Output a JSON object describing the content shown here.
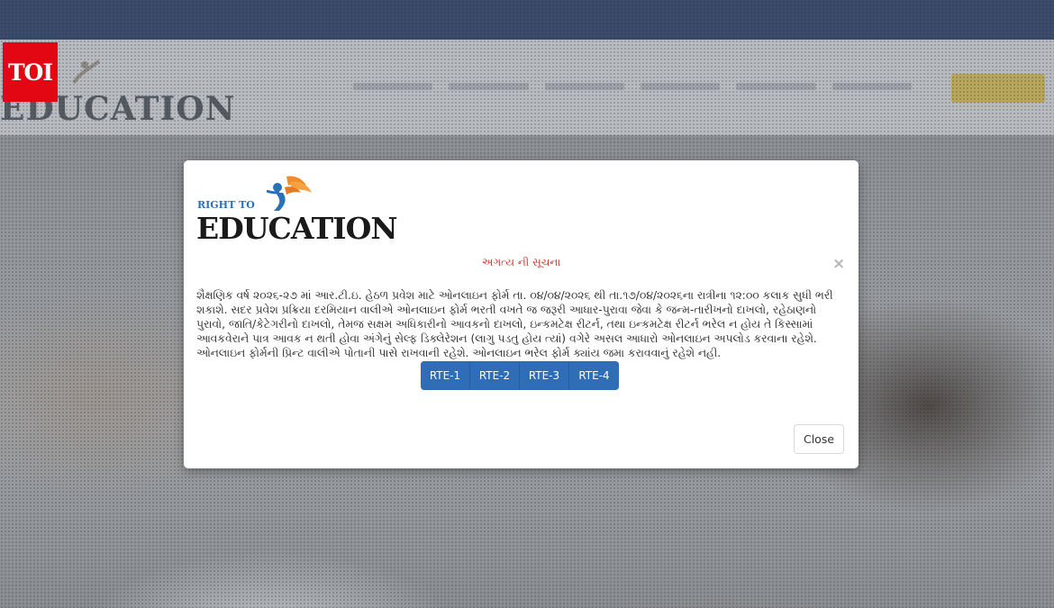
{
  "watermark": {
    "label": "TOI",
    "color": "#e30613"
  },
  "background": {
    "logo_text": "EDUCATION"
  },
  "modal": {
    "logo": {
      "line1": "RIGHT TO",
      "line2": "EDUCATION"
    },
    "title": "અગત્ય ની સૂચના",
    "close_x": "×",
    "body": "શૈક્ષણિક વર્ષ ૨૦૨૬-૨૭ માં આર.ટી.ઇ. હેઠળ પ્રવેશ માટે ઓનલાઇન ફોર્મ તા. ૦૪/૦૪/૨૦૨૬ થી તા.૧૭/૦૪/૨૦૨૬ના રાત્રીના ૧૨:૦૦ કલાક સુધી ભરી શકાશે. સદર પ્રવેશ પ્રક્રિયા દરમિયાન વાલીએ ઓનલાઇન ફોર્મ ભરતી વખતે જ જરૂરી આધાર-પુરાવા જેવા કે જન્મ-તારીખનો દાખલો, રહેઠાણનો પુરાવો, જાતિ/કેટેગરીનો દાખલો, તેમજ સક્ષમ અધિકારીનો આવકનો દાખલો, ઇન્કમટેક્ષ રીટર્ન, તથા ઇન્કમટેક્ષ રીટર્ન ભરેલ ન હોય તે કિસ્સામાં આવકવેરાને પાત્ર આવક ન થતી હોવા અંગેનું સેલ્ફ ડિક્લેરેશન (લાગુ પડતુ હોય ત્યાં) વગેરે અસલ આધારો ઓનલાઇન અપલોડ કરવાના રહેશે. ઓનલાઇન ફોર્મની પ્રિન્ટ વાલીએ પોતાની પાસે રાખવાની રહેશે. ઓનલાઇન ભરેલ ફોર્મ ક્યાંય જમા કરાવવાનું રહેશે નહી.",
    "rte_buttons": [
      {
        "label": "RTE-1"
      },
      {
        "label": "RTE-2"
      },
      {
        "label": "RTE-3"
      },
      {
        "label": "RTE-4"
      }
    ],
    "close_button": "Close"
  },
  "colors": {
    "title_red": "#d9312b",
    "button_blue": "#2f6db6",
    "logo_blue": "#2a71b8",
    "logo_orange": "#f28c28"
  },
  "icons": [
    "flying-figure-logo-icon",
    "close-icon"
  ]
}
